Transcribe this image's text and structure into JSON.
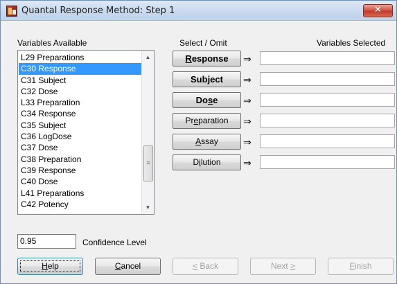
{
  "window": {
    "title": "Quantal Response Method: Step 1",
    "close_glyph": "✕",
    "app_icon": "spreadsheet-app-icon"
  },
  "variables": {
    "heading": "Variables Available",
    "items": [
      "L29 Preparations",
      "C30 Response",
      "C31 Subject",
      "C32 Dose",
      "L33 Preparation",
      "C34 Response",
      "C35 Subject",
      "C36 LogDose",
      "C37 Dose",
      "C38 Preparation",
      "C39 Response",
      "C40 Dose",
      "L41 Preparations",
      "C42 Potency"
    ],
    "selected": "C30 Response"
  },
  "select_omit": {
    "heading": "Select / Omit",
    "selected_heading": "Variables Selected",
    "arrow": "⇒",
    "buttons": [
      {
        "label_underlined": "R",
        "label_rest": "esponse",
        "value": ""
      },
      {
        "label_underlined": "",
        "label_rest": "Subject",
        "value": ""
      },
      {
        "label_prefix": "Do",
        "label_underlined": "s",
        "label_rest": "e",
        "value": ""
      },
      {
        "label_prefix": "Pr",
        "label_underlined": "e",
        "label_rest": "paration",
        "value": ""
      },
      {
        "label_underlined": "A",
        "label_rest": "ssay",
        "value": ""
      },
      {
        "label_prefix": "D",
        "label_underlined": "i",
        "label_rest": "lution",
        "value": ""
      }
    ]
  },
  "confidence": {
    "value": "0.95",
    "label": "Confidence Level"
  },
  "footer": {
    "help": {
      "underlined": "H",
      "rest": "elp"
    },
    "cancel": {
      "underlined": "C",
      "rest": "ancel"
    },
    "back": {
      "underlined": "<",
      "rest": " Back"
    },
    "next": {
      "prefix": "Next ",
      "underlined": ">"
    },
    "finish": {
      "underlined": "F",
      "rest": "inish"
    }
  },
  "colors": {
    "selection": "#3399ff",
    "title_bar": "#c9d9ee",
    "close_button": "#c23a2c",
    "disabled_text": "#a0a0a0"
  }
}
